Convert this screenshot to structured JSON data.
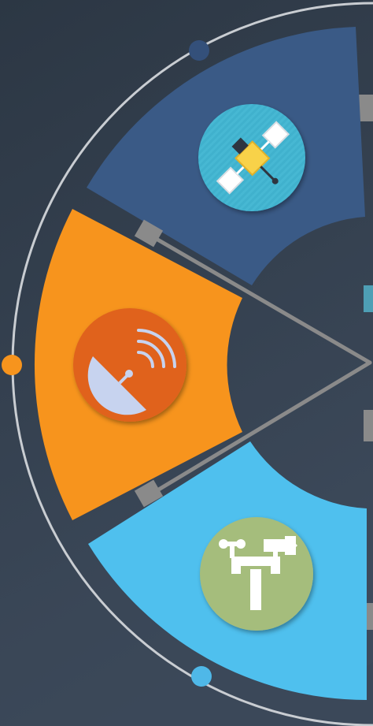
{
  "colors": {
    "background_dark": "#2c3744",
    "background_light": "#3d4a5b",
    "segment_top": "#3a5a86",
    "segment_middle": "#f7941d",
    "segment_bottom": "#4fc0ee",
    "icon_top_circle": "#3fb1cd",
    "icon_middle_circle": "#e0621e",
    "icon_bottom_circle": "#a5bd7c",
    "outer_ring": "#c9cdd2",
    "connector": "#888888",
    "dot_top": "#34507a",
    "dot_middle": "#f7941d",
    "dot_bottom": "#4fb8e8"
  },
  "segments": [
    {
      "position": "top",
      "icon": "satellite-icon"
    },
    {
      "position": "middle",
      "icon": "satellite-dish-icon"
    },
    {
      "position": "bottom",
      "icon": "weather-station-icon"
    }
  ]
}
